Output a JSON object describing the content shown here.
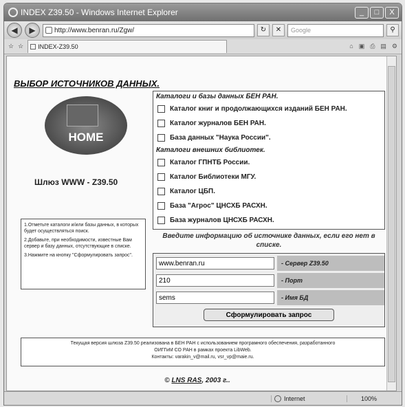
{
  "window": {
    "title": "INDEX Z39.50 - Windows Internet Explorer",
    "min": "_",
    "max": "□",
    "close": "X"
  },
  "address": {
    "url": "http://www.benran.ru/Zgw/",
    "search_placeholder": "Google"
  },
  "tab": {
    "label": "INDEX-Z39.50"
  },
  "page": {
    "heading": "ВЫБОР ИСТОЧНИКОВ ДАННЫХ.",
    "home_label": "HOME",
    "gateway": "Шлюз WWW - Z39.50",
    "instructions": [
      "1.Отметьте каталоги и/или базы данных, в которых будет осуществляться поиск.",
      "2.Добавьте, при необходимости, известные Вам сервер и базу данных, отсутствующие в списке.",
      "3.Нажмите на кнопку \"Сформулировать запрос\"."
    ],
    "ben_section": "Каталоги и базы данных БЕН РАН.",
    "ben_items": [
      "Каталог книг и продолжающихся изданий БЕН РАН.",
      "Каталог журналов БЕН РАН.",
      "База данных \"Наука России\"."
    ],
    "ext_section": "Каталоги внешних библиотек.",
    "ext_items": [
      "Каталог ГПНТБ России.",
      "Каталог Библиотеки МГУ.",
      "Каталог ЦБП.",
      "База \"Агрос\" ЦНСХБ РАСХН.",
      "База журналов ЦНСХБ РАСХН."
    ],
    "prompt": "Введите информацию об источнике данных, если его нет в списке.",
    "server": {
      "value": "www.benran.ru",
      "label": "- Сервер Z39.50"
    },
    "port": {
      "value": "210",
      "label": "- Порт"
    },
    "db": {
      "value": "sems",
      "label": "- Имя БД"
    },
    "submit": "Сформулировать запрос",
    "footer": [
      "Текущая версия шлюза Z39.50 реализована в БЕН РАН с использованием програмного обеспечения, разработанного",
      "ОИГГиМ СО РАН в рамках проекта LibWeb.",
      "Контакты: varakin_v@mail.ru, vsr_vp@maie.ru."
    ],
    "copyright_prefix": "©",
    "copyright_link": "LNS RAS",
    "copyright_suffix": ", 2003 г.."
  },
  "status": {
    "zone": "Internet",
    "zoom": "100%"
  }
}
